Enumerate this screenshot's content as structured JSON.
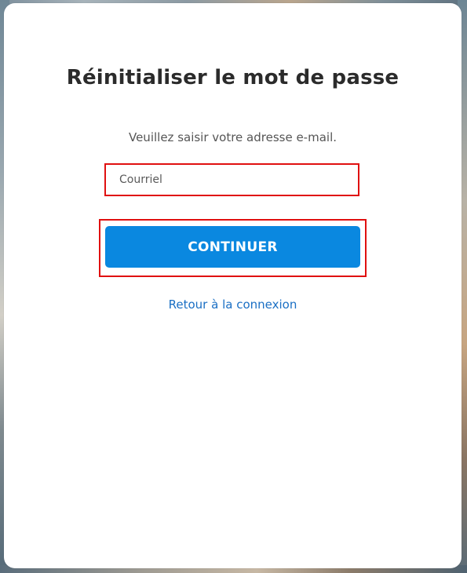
{
  "page": {
    "title": "Réinitialiser le mot de passe",
    "instruction": "Veuillez saisir votre adresse e-mail."
  },
  "form": {
    "email_placeholder": "Courriel",
    "email_value": "",
    "submit_label": "CONTINUER"
  },
  "links": {
    "back_to_login": "Retour à la connexion"
  },
  "colors": {
    "primary_button": "#0a88e0",
    "link": "#1a6fc4",
    "highlight_border": "#e01010",
    "title_text": "#2b2b2b"
  }
}
